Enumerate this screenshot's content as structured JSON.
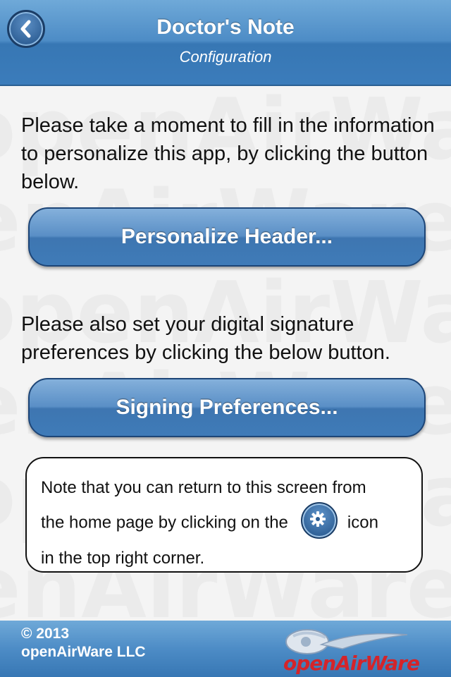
{
  "nav": {
    "title": "Doctor's Note",
    "subtitle": "Configuration",
    "back_icon": "chevron-left-icon"
  },
  "content": {
    "intro_text": "Please take a moment to fill in the information to personalize this app, by clicking the button below.",
    "personalize_button": "Personalize Header...",
    "signature_text": "Please also set your digital signature preferences by clicking the below button.",
    "signing_button": "Signing Preferences..."
  },
  "note": {
    "line1": "Note that you can return to this screen from",
    "line2_before": "the home page by clicking on the",
    "line2_after": "icon",
    "line3": "in the top right corner.",
    "icon": "gear-icon"
  },
  "footer": {
    "copyright_line1": "© 2013",
    "copyright_line2": "openAirWare LLC",
    "logo_text": "openAirWare"
  },
  "colors": {
    "bar_blue": "#4d8cc6",
    "button_blue": "#5a8fc6",
    "logo_red": "#d4242a"
  }
}
